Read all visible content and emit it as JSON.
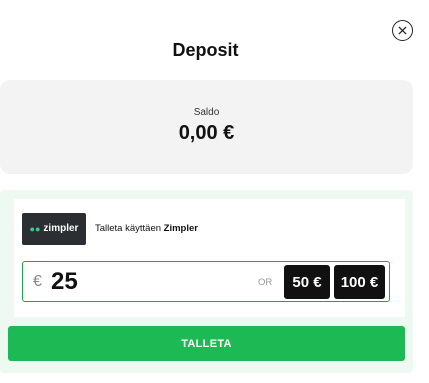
{
  "modal": {
    "title": "Deposit",
    "close_icon": "close-circle-icon"
  },
  "balance": {
    "label": "Saldo",
    "value": "0,00 €"
  },
  "provider": {
    "logo_mark": "●●",
    "logo_text": "zimpler",
    "text_prefix": "Talleta käyttäen ",
    "name": "Zimpler"
  },
  "amount": {
    "currency_symbol": "€",
    "value": "25",
    "or_label": "OR",
    "presets": [
      "50 €",
      "100 €"
    ]
  },
  "submit": {
    "label": "TALLETA"
  },
  "colors": {
    "accent_green": "#1db954",
    "panel_green": "#eefaf1",
    "input_border": "#1aa64a",
    "preset_bg": "#111111"
  }
}
